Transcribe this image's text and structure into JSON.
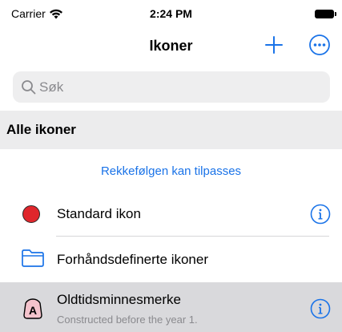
{
  "status_bar": {
    "carrier": "Carrier",
    "time": "2:24 PM",
    "wifi_icon": "wifi-icon",
    "battery_icon": "battery-icon"
  },
  "nav": {
    "title": "Ikoner",
    "add_icon": "plus-icon",
    "more_icon": "ellipsis-circle-icon"
  },
  "search": {
    "placeholder": "Søk",
    "icon": "search-icon"
  },
  "section": {
    "title": "Alle ikoner"
  },
  "hint": "Rekkefølgen kan tilpasses",
  "rows": [
    {
      "title": "Standard ikon",
      "icon": "red-dot-icon",
      "has_info": true
    },
    {
      "title": "Forhåndsdefinerte ikoner",
      "icon": "folder-icon",
      "has_info": false
    },
    {
      "title": "Oldtidsminnesmerke",
      "subtitle": "Constructed before the year 1.",
      "icon": "a-badge-icon",
      "has_info": true,
      "selected": true
    }
  ],
  "colors": {
    "accent": "#1a73e8",
    "red_dot": "#e0262c",
    "section_bg": "#ececed",
    "selected_row_bg": "#d9d9dc",
    "search_bg": "#eeeeef"
  }
}
